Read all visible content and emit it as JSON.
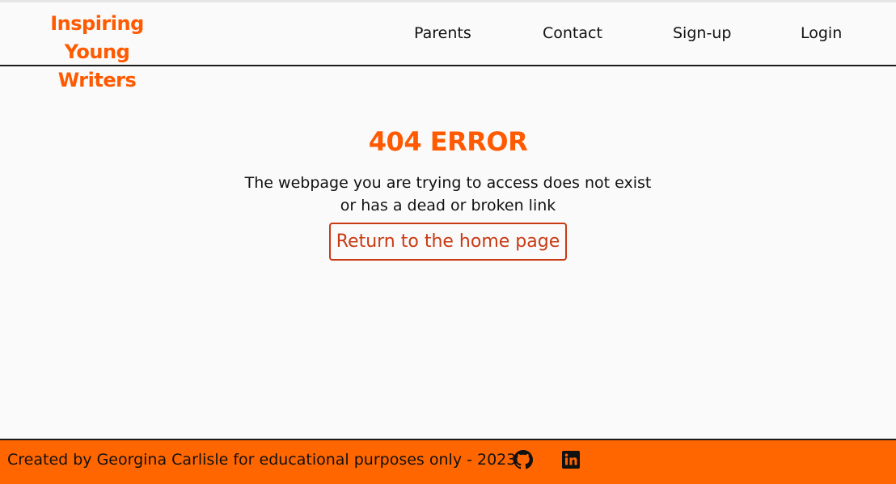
{
  "header": {
    "logo": "Inspiring Young Writers",
    "nav": [
      {
        "label": "Parents"
      },
      {
        "label": "Contact"
      },
      {
        "label": "Sign-up"
      },
      {
        "label": "Login"
      }
    ]
  },
  "main": {
    "title": "404 ERROR",
    "message_line1": "The webpage you are trying to access does not exist",
    "message_line2": "or has a dead or broken link",
    "home_button": "Return to the home page"
  },
  "footer": {
    "credit": "Created by Georgina Carlisle for educational purposes only - 2023",
    "icons": [
      "github-icon",
      "linkedin-icon"
    ]
  },
  "colors": {
    "accent": "#ff5a00",
    "footer_bg": "#ff6600",
    "button_border": "#c83a14",
    "background": "#fafafa"
  }
}
